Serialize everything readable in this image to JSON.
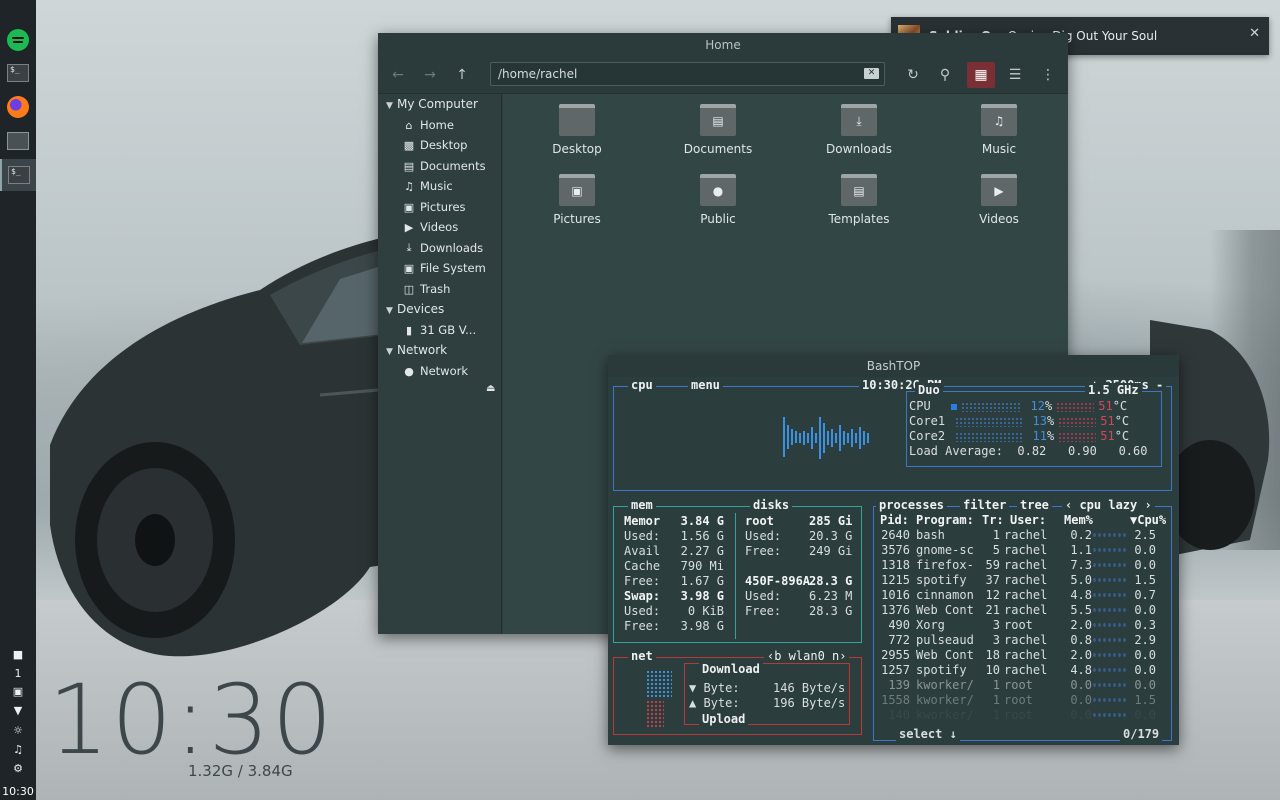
{
  "notification": {
    "title": "Soldier On",
    "body": "Oasis - Dig Out Your Soul",
    "close": "✕"
  },
  "desktop": {
    "clock": "10:30",
    "memory": "1.32G / 3.84G"
  },
  "dock": {
    "items": [
      "spotify-icon",
      "terminal-icon",
      "firefox-icon",
      "file-manager-icon",
      "terminal-icon"
    ],
    "tray_count": "1",
    "tray_clock": "10:30"
  },
  "file_manager": {
    "title": "Home",
    "path": "/home/rachel",
    "sidebar": {
      "my_computer": "My Computer",
      "computer_items": [
        "Home",
        "Desktop",
        "Documents",
        "Music",
        "Pictures",
        "Videos",
        "Downloads",
        "File System",
        "Trash"
      ],
      "devices": "Devices",
      "device_items": [
        "31 GB V..."
      ],
      "network": "Network",
      "network_items": [
        "Network"
      ]
    },
    "folders": [
      "Desktop",
      "Documents",
      "Downloads",
      "Music",
      "Pictures",
      "Public",
      "Templates",
      "Videos"
    ]
  },
  "bashtop": {
    "title": "BashTOP",
    "cpu": {
      "label": "cpu",
      "menu": "menu",
      "time": "10:30:26 PM",
      "interval": "+ 2500ms -",
      "model": "Duo",
      "freq": "1.5 GHz",
      "rows": [
        {
          "name": "CPU",
          "pct": "12",
          "temp": "51"
        },
        {
          "name": "Core1",
          "pct": "13",
          "temp": "51"
        },
        {
          "name": "Core2",
          "pct": "11",
          "temp": "51"
        }
      ],
      "pct_unit": "%",
      "temp_unit": "°C",
      "load_label": "Load Average:",
      "load": [
        "0.82",
        "0.90",
        "0.60"
      ]
    },
    "mem": {
      "label": "mem",
      "rows": [
        {
          "k": "Memor",
          "v": "3.84 G",
          "bold": true
        },
        {
          "k": "Used:",
          "v": "1.56 G"
        },
        {
          "k": "Avail",
          "v": "2.27 G"
        },
        {
          "k": "Cache",
          "v": "790 Mi"
        },
        {
          "k": "Free:",
          "v": "1.67 G"
        },
        {
          "k": "Swap:",
          "v": "3.98 G",
          "bold": true
        },
        {
          "k": "Used:",
          "v": "0 KiB"
        },
        {
          "k": "Free:",
          "v": "3.98 G"
        }
      ]
    },
    "disks": {
      "label": "disks",
      "rows": [
        {
          "k": "root",
          "v": "285 Gi",
          "bold": true
        },
        {
          "k": "Used:",
          "v": "20.3 G"
        },
        {
          "k": "Free:",
          "v": "249 Gi"
        },
        {
          "k": "",
          "v": ""
        },
        {
          "k": "450F-896A",
          "v": "28.3 G",
          "bold": true
        },
        {
          "k": "Used:",
          "v": "6.23 M"
        },
        {
          "k": "Free:",
          "v": "28.3 G"
        }
      ]
    },
    "net": {
      "label": "net",
      "iface": "‹b wlan0 n›",
      "download": "Download",
      "upload": "Upload",
      "down_label": "▼ Byte:",
      "down_val": "146 Byte/s",
      "up_label": "▲ Byte:",
      "up_val": "196 Byte/s"
    },
    "proc": {
      "label": "processes",
      "filter": "filter",
      "tree": "tree",
      "sort": "‹ cpu lazy ›",
      "headers": [
        "Pid:",
        "Program:",
        "Tr:",
        "User:",
        "Mem%",
        "▼Cpu%"
      ],
      "rows": [
        [
          "2640",
          "bash",
          "1",
          "rachel",
          "0.2",
          "2.5"
        ],
        [
          "3576",
          "gnome-sc",
          "5",
          "rachel",
          "1.1",
          "0.0"
        ],
        [
          "1318",
          "firefox-",
          "59",
          "rachel",
          "7.3",
          "0.0"
        ],
        [
          "1215",
          "spotify",
          "37",
          "rachel",
          "5.0",
          "1.5"
        ],
        [
          "1016",
          "cinnamon",
          "12",
          "rachel",
          "4.8",
          "0.7"
        ],
        [
          "1376",
          "Web Cont",
          "21",
          "rachel",
          "5.5",
          "0.0"
        ],
        [
          "490",
          "Xorg",
          "3",
          "root",
          "2.0",
          "0.3"
        ],
        [
          "772",
          "pulseaud",
          "3",
          "rachel",
          "0.8",
          "2.9"
        ],
        [
          "2955",
          "Web Cont",
          "18",
          "rachel",
          "2.0",
          "0.0"
        ],
        [
          "1257",
          "spotify",
          "10",
          "rachel",
          "4.8",
          "0.0"
        ],
        [
          "139",
          "kworker/",
          "1",
          "root",
          "0.0",
          "0.0"
        ],
        [
          "1558",
          "kworker/",
          "1",
          "root",
          "0.0",
          "1.5"
        ],
        [
          "140",
          "kworker/",
          "1",
          "root",
          "0.0",
          "0.0"
        ]
      ],
      "select": "select ↓",
      "count": "0/179"
    }
  }
}
